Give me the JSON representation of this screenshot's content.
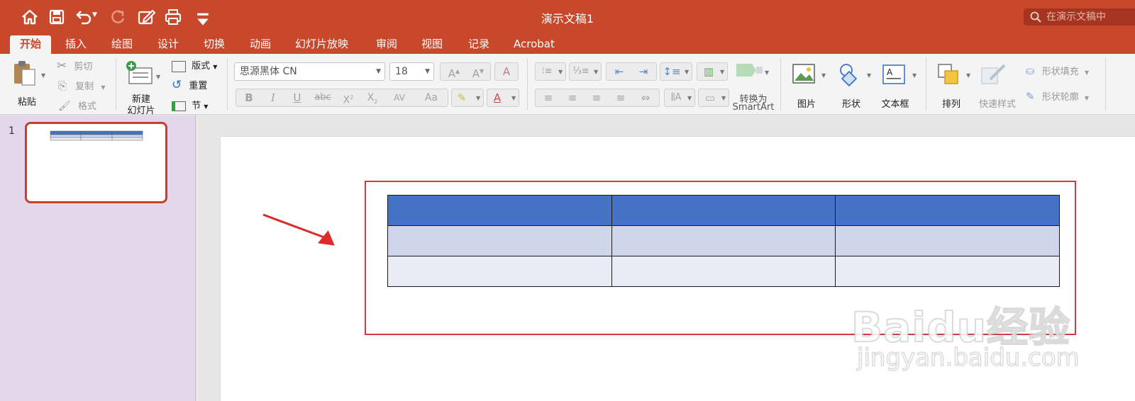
{
  "app": {
    "title": "演示文稿1",
    "search_placeholder": "在演示文稿中"
  },
  "tabs": [
    {
      "label": "开始",
      "active": true
    },
    {
      "label": "插入"
    },
    {
      "label": "绘图"
    },
    {
      "label": "设计"
    },
    {
      "label": "切换"
    },
    {
      "label": "动画"
    },
    {
      "label": "幻灯片放映"
    },
    {
      "label": "审阅"
    },
    {
      "label": "视图"
    },
    {
      "label": "记录"
    },
    {
      "label": "Acrobat"
    }
  ],
  "ribbon": {
    "clipboard": {
      "paste": "粘贴",
      "cut": "剪切",
      "copy": "复制",
      "format": "格式"
    },
    "slides": {
      "new_slide_line1": "新建",
      "new_slide_line2": "幻灯片",
      "layout": "版式",
      "reset": "重置",
      "section": "节"
    },
    "font": {
      "font_name": "思源黑体 CN",
      "font_size": "18"
    },
    "paragraph": {
      "smartart_line1": "转换为",
      "smartart_line2": "SmartArt"
    },
    "insert": {
      "picture": "图片",
      "shape": "形状",
      "textbox": "文本框"
    },
    "drawing": {
      "arrange": "排列",
      "quick_styles": "快速样式",
      "shape_fill": "形状填充",
      "shape_outline": "形状轮廓"
    }
  },
  "thumbnails": [
    {
      "number": "1",
      "selected": true
    }
  ],
  "slide": {
    "table": {
      "rows": 3,
      "cols": 3,
      "header_color": "#4472c4",
      "band1_color": "#cfd5ea",
      "band2_color": "#e9ebf5"
    }
  },
  "watermark": {
    "logo": "Baidu经验",
    "url": "jingyan.baidu.com"
  },
  "colors": {
    "accent": "#c8482b",
    "highlight_box": "#d33a41",
    "arrow": "#e02a2a"
  }
}
